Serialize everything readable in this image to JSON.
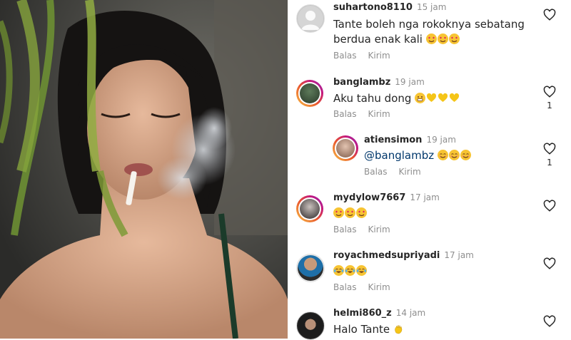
{
  "comments": [
    {
      "username": "suhartono8110",
      "time": "15 jam",
      "text": "Tante boleh nga rokoknya sebatang berdua enak kali",
      "emoji": [
        "heart-eyes",
        "heart-eyes",
        "heart-eyes"
      ],
      "reply_label": "Balas",
      "send_label": "Kirim",
      "likes": ""
    },
    {
      "username": "banglambz",
      "time": "19 jam",
      "text": "Aku tahu dong",
      "emoji": [
        "grin",
        "yellow-heart",
        "yellow-heart",
        "yellow-heart"
      ],
      "reply_label": "Balas",
      "send_label": "Kirim",
      "likes": "1"
    },
    {
      "username": "atiensimon",
      "time": "19 jam",
      "mention": "@banglambz",
      "text": "",
      "emoji": [
        "smile",
        "smile",
        "smile"
      ],
      "reply_label": "Balas",
      "send_label": "Kirim",
      "likes": "1"
    },
    {
      "username": "mydylow7667",
      "time": "17 jam",
      "text": "",
      "emoji": [
        "heart-eyes",
        "heart-eyes",
        "heart-eyes"
      ],
      "reply_label": "Balas",
      "send_label": "Kirim",
      "likes": ""
    },
    {
      "username": "royachmedsupriyadi",
      "time": "17 jam",
      "text": "",
      "emoji": [
        "tears-of-joy",
        "tears-of-joy",
        "tears-of-joy"
      ],
      "reply_label": "Balas",
      "send_label": "Kirim",
      "likes": ""
    },
    {
      "username": "helmi860_z",
      "time": "14 jam",
      "text": "Halo Tante",
      "emoji": [
        "waving-hand"
      ],
      "reply_label": "",
      "send_label": "",
      "likes": ""
    }
  ],
  "colors": {
    "username": "#262626",
    "meta": "#8e8e8e",
    "mention": "#00376b",
    "story_ring": [
      "#f9c244",
      "#e8562e",
      "#c3157e",
      "#8a3ab9"
    ]
  }
}
